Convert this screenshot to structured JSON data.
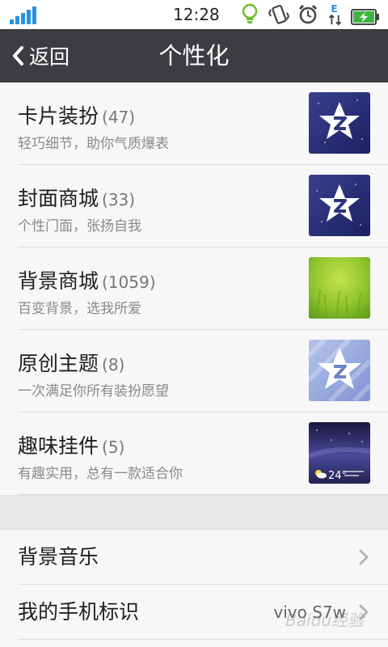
{
  "status_bar": {
    "time": "12:28",
    "network_type": "E",
    "icons": [
      "signal-icon",
      "bulb-icon",
      "vibrate-icon",
      "alarm-icon",
      "data-e-icon",
      "battery-charging-icon"
    ]
  },
  "header": {
    "back_label": "返回",
    "title": "个性化"
  },
  "cards": [
    {
      "title": "卡片装扮",
      "count": "(47)",
      "subtitle": "轻巧细节，助你气质爆表",
      "thumb": "qq-star-icon-dark"
    },
    {
      "title": "封面商城",
      "count": "(33)",
      "subtitle": "个性门面，张扬自我",
      "thumb": "qq-star-icon-dark"
    },
    {
      "title": "背景商城",
      "count": "(1059)",
      "subtitle": "百变背景，选我所爱",
      "thumb": "green-grass-image"
    },
    {
      "title": "原创主题",
      "count": "(8)",
      "subtitle": "一次满足你所有装扮愿望",
      "thumb": "qq-star-icon-light"
    },
    {
      "title": "趣味挂件",
      "count": "(5)",
      "subtitle": "有趣实用，总有一款适合你",
      "thumb": "weather-widget-image"
    }
  ],
  "widget_preview": {
    "temperature": "24°"
  },
  "settings": [
    {
      "label": "背景音乐",
      "value": ""
    },
    {
      "label": "我的手机标识",
      "value": "vivo S7w"
    }
  ],
  "watermark": "Baidu经验",
  "colors": {
    "header_bg": "#3c3d41",
    "signal": "#2a91e0",
    "battery": "#3fb53f",
    "list_bg": "#f7f7f7"
  }
}
